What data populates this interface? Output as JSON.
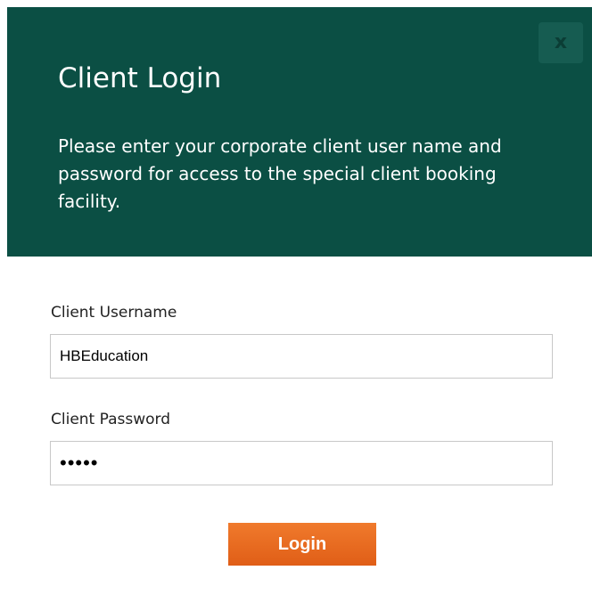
{
  "dialog": {
    "title": "Client Login",
    "description": "Please enter your corporate client user name and password for access to the special client booking facility.",
    "close_label": "x"
  },
  "form": {
    "username_label": "Client Username",
    "username_value": "HBEducation",
    "password_label": "Client Password",
    "password_value": "•••••",
    "login_label": "Login"
  },
  "colors": {
    "header_bg": "#0b4f44",
    "button_accent": "#e8691f"
  }
}
